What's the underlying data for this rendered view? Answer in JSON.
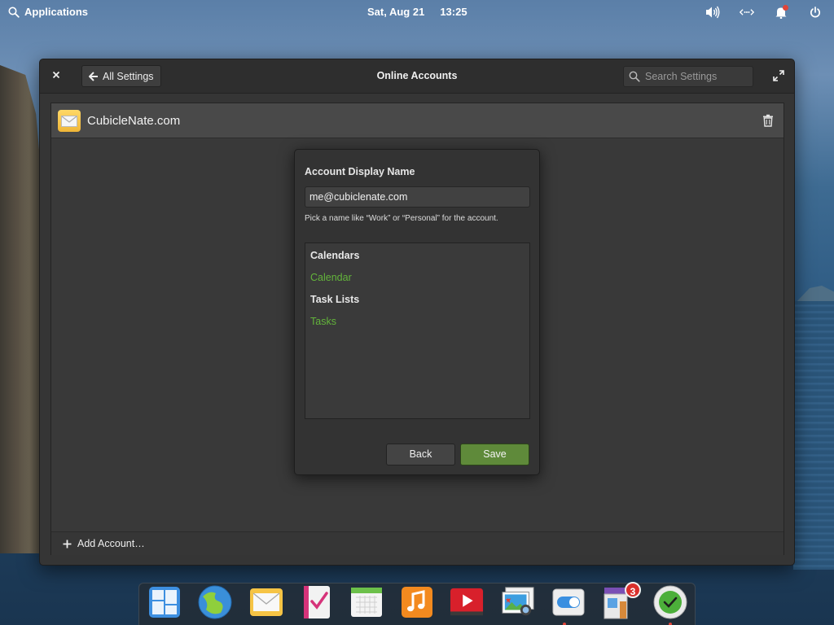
{
  "top_panel": {
    "applications_label": "Applications",
    "date": "Sat, Aug 21",
    "time": "13:25",
    "indicators": [
      "volume-icon",
      "network-icon",
      "notifications-icon",
      "power-icon"
    ]
  },
  "window": {
    "title": "Online Accounts",
    "back_button_label": "All Settings",
    "search_placeholder": "Search Settings"
  },
  "account": {
    "name": "CubicleNate.com"
  },
  "dialog": {
    "title": "Account Display Name",
    "entry_value": "me@cubiclenate.com",
    "hint": "Pick a name like “Work” or “Personal” for the account.",
    "sections": [
      {
        "heading": "Calendars",
        "item": "Calendar"
      },
      {
        "heading": "Task Lists",
        "item": "Tasks"
      }
    ],
    "back_label": "Back",
    "save_label": "Save"
  },
  "footer": {
    "add_account_label": "Add Account…"
  },
  "dock": {
    "apps": [
      {
        "name": "multitasking-view-icon"
      },
      {
        "name": "web-browser-icon"
      },
      {
        "name": "mail-icon"
      },
      {
        "name": "tasks-icon"
      },
      {
        "name": "calendar-icon"
      },
      {
        "name": "music-icon"
      },
      {
        "name": "videos-icon"
      },
      {
        "name": "photos-icon"
      },
      {
        "name": "system-settings-icon"
      },
      {
        "name": "appcenter-icon",
        "badge": "3"
      },
      {
        "name": "updates-icon"
      }
    ]
  },
  "colors": {
    "accent_green": "#63b43b",
    "save_button": "#5f8a3a",
    "badge_red": "#d9302c"
  }
}
